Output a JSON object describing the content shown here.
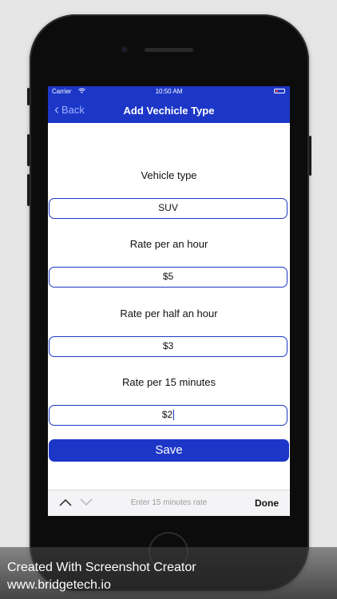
{
  "status_bar": {
    "carrier": "Carrier",
    "time": "10:50 AM"
  },
  "nav": {
    "back_label": "Back",
    "title": "Add Vechicle Type"
  },
  "form": {
    "fields": [
      {
        "label": "Vehicle type",
        "value": "SUV"
      },
      {
        "label": "Rate per an hour",
        "value": "$5"
      },
      {
        "label": "Rate per half an hour",
        "value": "$3"
      },
      {
        "label": "Rate per 15 minutes",
        "value": "$2"
      }
    ],
    "save_label": "Save"
  },
  "keyboard_toolbar": {
    "placeholder": "Enter 15 minutes rate",
    "done_label": "Done"
  },
  "caption": {
    "line1": "Created With Screenshot Creator",
    "line2": "www.bridgetech.io"
  },
  "colors": {
    "accent": "#1c37c7",
    "background": "#e6e6e6",
    "phone": "#0c0c0c"
  },
  "icons": [
    "wifi-icon",
    "battery-icon",
    "chevron-left-icon",
    "chevron-up-icon",
    "chevron-down-icon"
  ]
}
